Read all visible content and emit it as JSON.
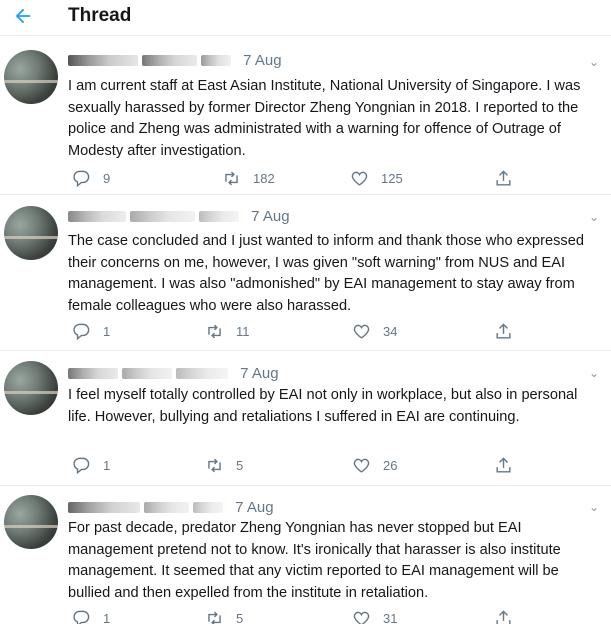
{
  "header": {
    "title": "Thread",
    "back_icon": "arrow-left-icon"
  },
  "colors": {
    "accent": "#1da1f2",
    "muted": "#657786",
    "divider": "#e6ecf0"
  },
  "tweets": [
    {
      "date": "7 Aug",
      "text": "I am   current staff at East Asian Institute, National University of Singapore. I was sexually harassed by former Director Zheng Yongnian in 2018. I reported to the police and Zheng was administrated with a warning for offence of Outrage of Modesty after investigation.",
      "replies": "9",
      "retweets": "182",
      "likes": "125"
    },
    {
      "date": "7 Aug",
      "text": "The case concluded and I just wanted to inform and thank those who expressed their concerns on me, however, I was given \"soft warning\" from NUS and EAI management. I was also \"admonished\" by EAI management to stay away from female colleagues who were also harassed.",
      "replies": "1",
      "retweets": "11",
      "likes": "34"
    },
    {
      "date": "7 Aug",
      "text": "I feel myself totally controlled by EAI not only in workplace, but also in personal life. However, bullying and retaliations I suffered in EAI are continuing.",
      "replies": "1",
      "retweets": "5",
      "likes": "26"
    },
    {
      "date": "7 Aug",
      "text": "For past decade, predator Zheng Yongnian has never stopped but EAI management pretend not to know. It's ironically that harasser is also institute management. It seemed that any victim reported to EAI management will be bullied and then expelled from the institute in retaliation.",
      "replies": "1",
      "retweets": "5",
      "likes": "31"
    }
  ]
}
